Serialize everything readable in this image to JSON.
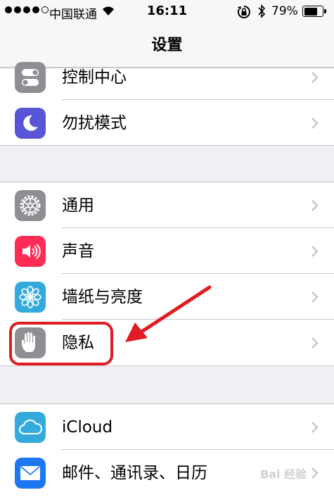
{
  "status_bar": {
    "carrier": "中国联通",
    "time": "16:11",
    "battery_percent": "79%",
    "battery_level": 0.79
  },
  "nav": {
    "title": "设置"
  },
  "groups": [
    {
      "rows": [
        {
          "label": "控制中心",
          "icon": "control-center-icon",
          "color": "#8e8e93"
        },
        {
          "label": "勿扰模式",
          "icon": "moon-icon",
          "color": "#5856d6"
        }
      ]
    },
    {
      "rows": [
        {
          "label": "通用",
          "icon": "gear-icon",
          "color": "#8e8e93"
        },
        {
          "label": "声音",
          "icon": "speaker-icon",
          "color": "#ff2d55"
        },
        {
          "label": "墙纸与亮度",
          "icon": "flower-icon",
          "color": "#34aadc"
        },
        {
          "label": "隐私",
          "icon": "hand-icon",
          "color": "#8e8e93"
        }
      ]
    },
    {
      "rows": [
        {
          "label": "iCloud",
          "icon": "cloud-icon",
          "color": "#34aadc"
        },
        {
          "label": "邮件、通讯录、日历",
          "icon": "mail-icon",
          "color": "#1d77f2"
        }
      ]
    }
  ],
  "annotation": {
    "highlight_color": "#e01b23"
  },
  "watermark": "Bai 经验"
}
